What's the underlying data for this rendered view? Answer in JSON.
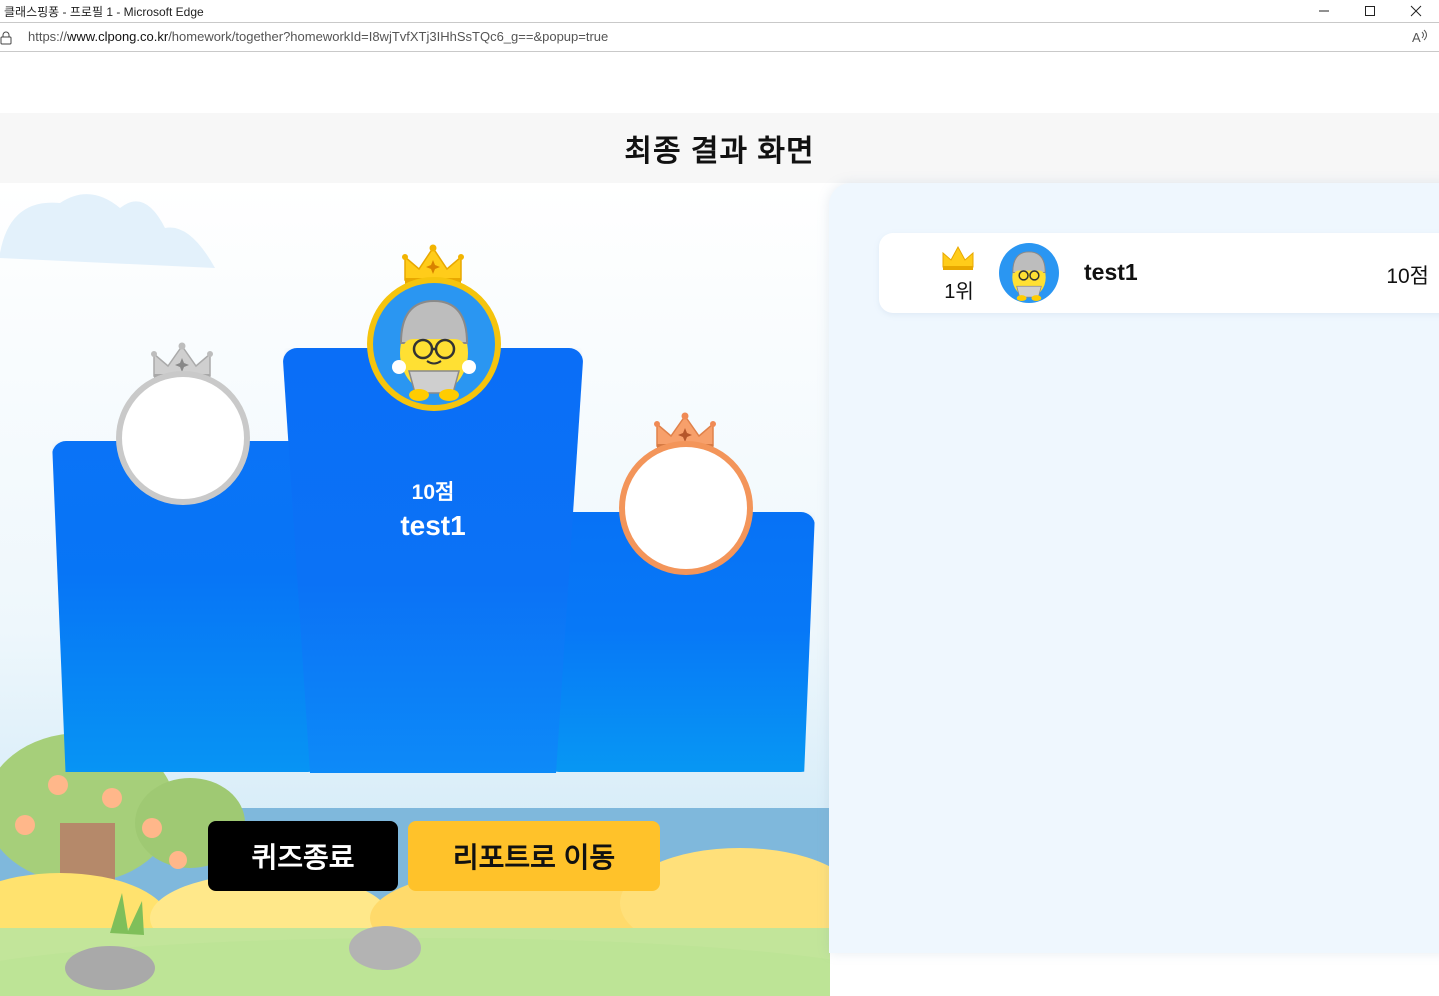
{
  "window": {
    "title": "클래스핑퐁 - 프로필 1 - Microsoft Edge"
  },
  "address_bar": {
    "url_scheme": "https://",
    "url_host": "www.clpong.co.kr",
    "url_path": "/homework/together?homeworkId=I8wjTvfXTj3IHhSsTQc6_g==&popup=true"
  },
  "page": {
    "title": "최종 결과 화면"
  },
  "podium": {
    "first": {
      "score": "10점",
      "name": "test1",
      "crown_color": "#f5c40d"
    },
    "second": {
      "crown_color": "#c9c9c9"
    },
    "third": {
      "crown_color": "#f3955a"
    }
  },
  "buttons": {
    "quiz_end": "퀴즈종료",
    "go_report": "리포트로 이동"
  },
  "ranking": [
    {
      "rank": "1위",
      "name": "test1",
      "score": "10점"
    }
  ],
  "colors": {
    "podium_blue": "#0a6ef7",
    "report_button": "#ffc22a",
    "end_button": "#000000",
    "panel_bg": "#eff7fe"
  },
  "icons": {
    "lock": "lock-icon",
    "read_aloud": "read-aloud-icon",
    "minimize": "minimize-icon",
    "maximize": "maximize-icon",
    "close": "close-icon",
    "crown": "crown-icon",
    "avatar": "knight-character-avatar"
  }
}
